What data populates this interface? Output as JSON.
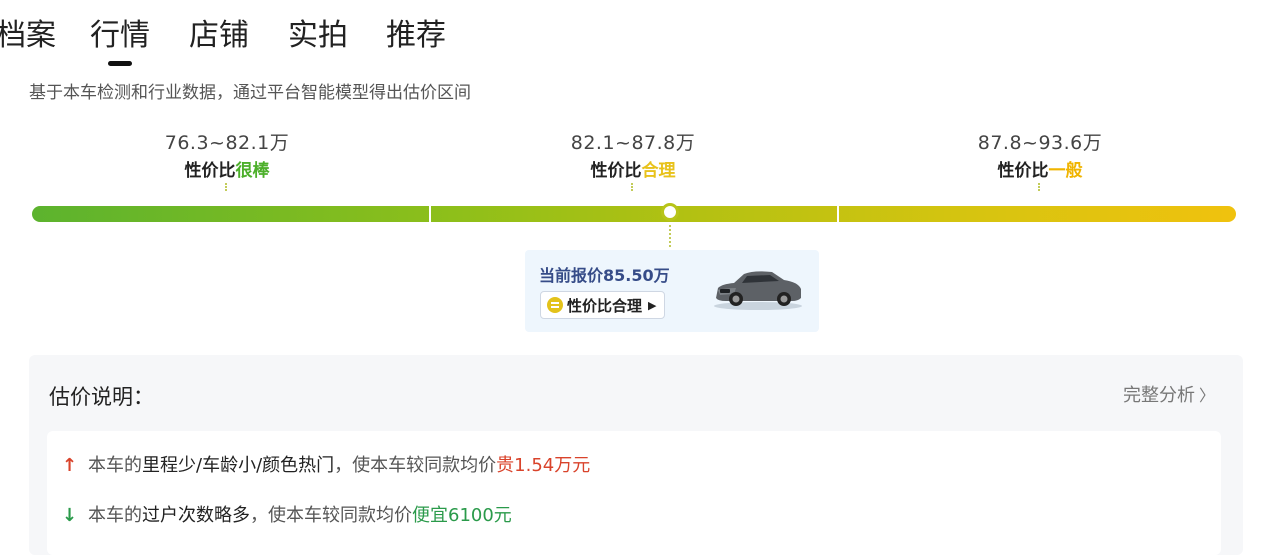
{
  "tabs": [
    "档案",
    "行情",
    "店铺",
    "实拍",
    "推荐"
  ],
  "active_tab": "行情",
  "subtitle": "基于本车检测和行业数据，通过平台智能模型得出估价区间",
  "ranges": [
    {
      "price": "76.3~82.1万",
      "label_prefix": "性价比",
      "label_suffix": "很棒",
      "color": "#4caf2a"
    },
    {
      "price": "82.1~87.8万",
      "label_prefix": "性价比",
      "label_suffix": "合理",
      "color": "#e8c21b"
    },
    {
      "price": "87.8~93.6万",
      "label_prefix": "性价比",
      "label_suffix": "一般",
      "color": "#f0b400"
    }
  ],
  "current_price": {
    "text": "当前报价85.50万",
    "value_wan": 85.5,
    "badge": "性价比合理",
    "badge_icon": "equal-circle-icon",
    "arrow": "▶"
  },
  "explain": {
    "title": "估价说明：",
    "more_label": "完整分析",
    "items": [
      {
        "icon": "arrow-up-icon",
        "glyph": "↑",
        "pre": "本车的",
        "bold": "里程少/车龄小/颜色热门",
        "mid": "，使本车较同款均价",
        "highlight": "贵1.54万元",
        "color": "#d9432b"
      },
      {
        "icon": "arrow-down-icon",
        "glyph": "↓",
        "pre": "本车的",
        "bold": "过户次数略多",
        "mid": "，使本车较同款均价",
        "highlight": "便宜6100元",
        "color": "#2a9a4a"
      }
    ]
  },
  "colors": {
    "green": "#5cb32e",
    "yellow": "#f0c20e",
    "card_bg": "#eef6fd"
  }
}
